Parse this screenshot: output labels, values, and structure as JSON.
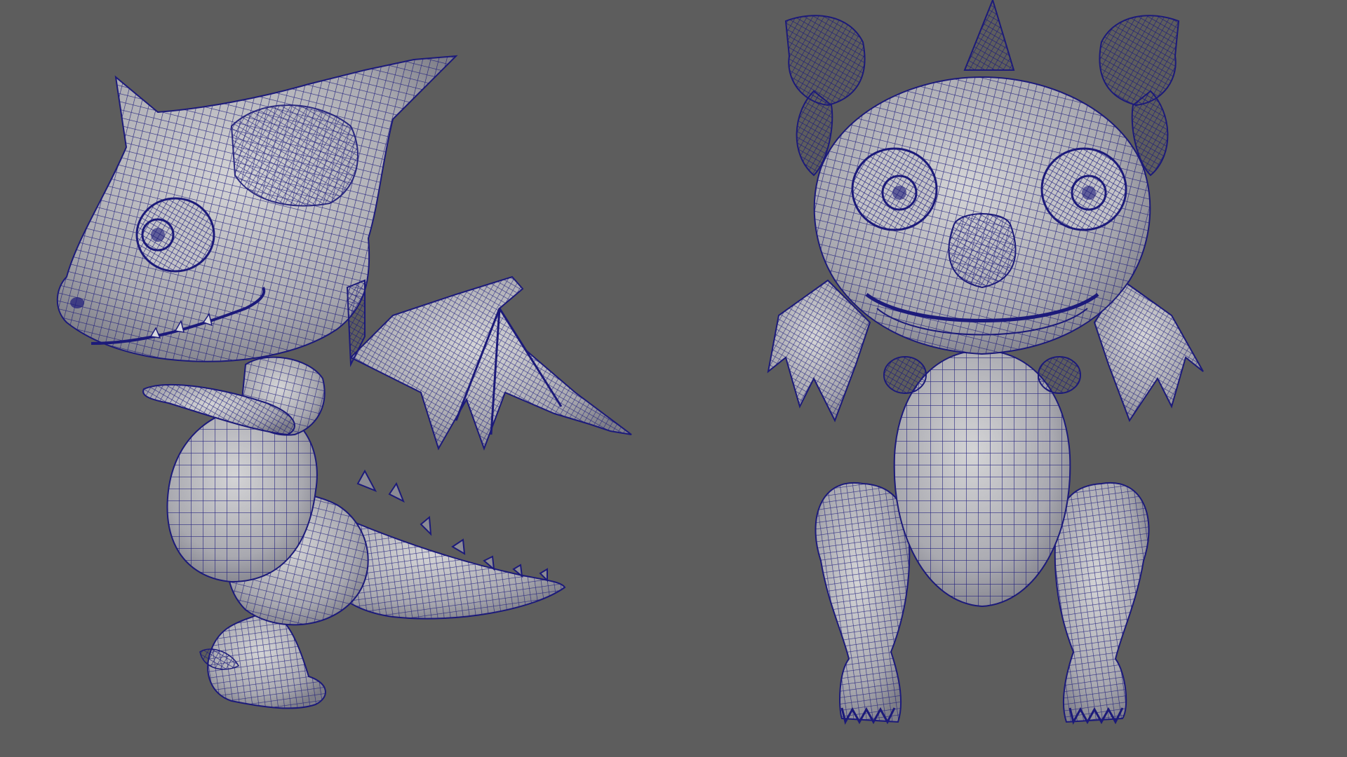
{
  "scene": {
    "background_color": "#5d5d5d",
    "mesh_fill_color": "#b9b9bd",
    "mesh_shade_color": "#8e8e96",
    "wire_color": "#1c1a7a",
    "models": [
      {
        "name": "dragon-side-view",
        "view": "side",
        "faces": "left"
      },
      {
        "name": "dragon-front-view",
        "view": "front",
        "faces": "viewer"
      }
    ]
  }
}
